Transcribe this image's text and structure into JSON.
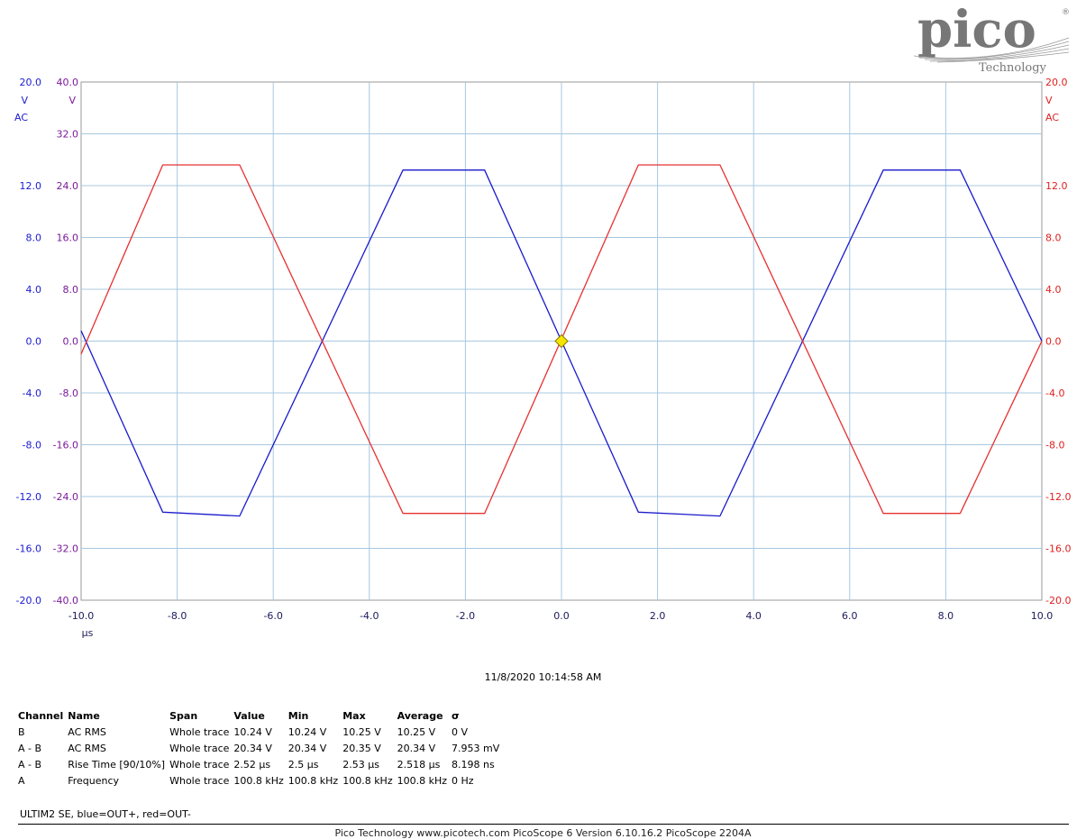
{
  "logo": {
    "brand": "pico",
    "sub": "Technology",
    "mark": "®"
  },
  "chart_data": {
    "type": "line",
    "xlabel_unit": "µs",
    "xlim": [
      -10,
      10
    ],
    "xticks": [
      "-10.0",
      "-8.0",
      "-6.0",
      "-4.0",
      "-2.0",
      "0.0",
      "2.0",
      "4.0",
      "6.0",
      "8.0",
      "10.0"
    ],
    "y_axes": [
      {
        "id": "left1",
        "unit": "V",
        "coupling": "AC",
        "top": "20.0",
        "ticks": [
          "20.0",
          "12.0",
          "8.0",
          "4.0",
          "0.0",
          "-4.0",
          "-8.0",
          "-12.0",
          "-16.0",
          "-20.0"
        ],
        "color": "#1a1ad0"
      },
      {
        "id": "left2",
        "unit": "V",
        "top": "40.0",
        "ticks": [
          "40.0",
          "32.0",
          "24.0",
          "16.0",
          "8.0",
          "0.0",
          "-8.0",
          "-16.0",
          "-24.0",
          "-32.0",
          "-40.0"
        ],
        "color": "#7a1a9a"
      },
      {
        "id": "right",
        "unit": "V",
        "coupling": "AC",
        "top": "20.0",
        "ticks": [
          "20.0",
          "12.0",
          "8.0",
          "4.0",
          "0.0",
          "-4.0",
          "-8.0",
          "-12.0",
          "-16.0",
          "-20.0"
        ],
        "color": "#e02020"
      }
    ],
    "ylim": [
      -20,
      20
    ],
    "series": [
      {
        "color": "#1a1acc",
        "x": [
          -10,
          -8.3,
          -6.7,
          -3.3,
          -1.6,
          1.6,
          3.3,
          6.7,
          8.3,
          10
        ],
        "y": [
          0.8,
          -13.2,
          -13.5,
          13.2,
          13.2,
          -13.2,
          -13.5,
          13.2,
          13.2,
          0
        ]
      },
      {
        "color": "#e83030",
        "x": [
          -10,
          -8.3,
          -6.7,
          -3.3,
          -1.6,
          1.6,
          3.3,
          6.7,
          8.3,
          10
        ],
        "y": [
          -1.0,
          13.6,
          13.6,
          -13.3,
          -13.3,
          13.6,
          13.6,
          -13.3,
          -13.3,
          0
        ]
      }
    ],
    "marker": {
      "x": 0,
      "y": 0,
      "color": "#f5e400"
    }
  },
  "timestamp": "11/8/2020 10:14:58 AM",
  "measurements": {
    "headers": [
      "Channel",
      "Name",
      "Span",
      "Value",
      "Min",
      "Max",
      "Average",
      "σ"
    ],
    "rows": [
      [
        "B",
        "AC RMS",
        "Whole trace",
        "10.24 V",
        "10.24 V",
        "10.25 V",
        "10.25 V",
        "0 V"
      ],
      [
        "A - B",
        "AC RMS",
        "Whole trace",
        "20.34 V",
        "20.34 V",
        "20.35 V",
        "20.34 V",
        "7.953 mV"
      ],
      [
        "A - B",
        "Rise Time  [90/10%]",
        "Whole trace",
        "2.52 µs",
        "2.5 µs",
        "2.53 µs",
        "2.518 µs",
        "8.198 ns"
      ],
      [
        "A",
        "Frequency",
        "Whole trace",
        "100.8 kHz",
        "100.8 kHz",
        "100.8 kHz",
        "100.8 kHz",
        "0 Hz"
      ]
    ]
  },
  "note": "ULTIM2 SE, blue=OUT+, red=OUT-",
  "footer": "Pico Technology     www.picotech.com     PicoScope 6 Version 6.10.16.2     PicoScope 2204A"
}
